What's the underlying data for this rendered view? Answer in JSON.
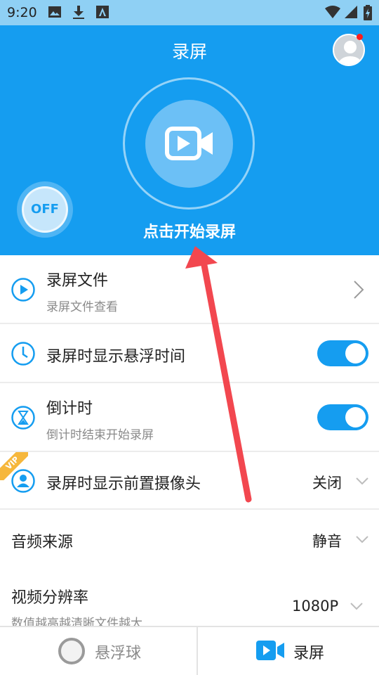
{
  "status_bar": {
    "time": "9:20"
  },
  "header": {
    "title": "录屏",
    "start_label": "点击开始录屏",
    "float_toggle_label": "OFF",
    "accent_color": "#159df0"
  },
  "rows": {
    "files": {
      "title": "录屏文件",
      "subtitle": "录屏文件查看"
    },
    "float_time": {
      "title": "录屏时显示悬浮时间",
      "enabled": true
    },
    "countdown": {
      "title": "倒计时",
      "subtitle": "倒计时结束开始录屏",
      "enabled": true
    },
    "front_camera": {
      "badge": "VIP",
      "title": "录屏时显示前置摄像头",
      "value": "关闭"
    },
    "audio_source": {
      "title": "音频来源",
      "value": "静音"
    },
    "resolution": {
      "title": "视频分辨率",
      "subtitle": "数值越高越清晰文件越大",
      "value": "1080P"
    }
  },
  "bottom_nav": {
    "float_ball": "悬浮球",
    "record": "录屏"
  },
  "icons": [
    "image-icon",
    "download-icon",
    "font-icon",
    "wifi-icon",
    "signal-icon",
    "battery-icon",
    "avatar-icon",
    "video-camera-icon",
    "play-icon",
    "clock-icon",
    "hourglass-icon",
    "person-icon",
    "chevron-right-icon",
    "chevron-down-icon",
    "circle-icon"
  ]
}
